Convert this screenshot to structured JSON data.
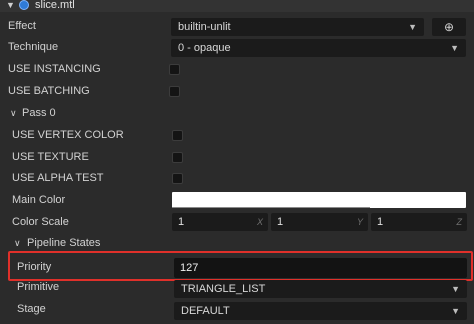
{
  "header": {
    "title": "slice.mtl",
    "chevron_icon": "chevron-down-icon",
    "file_icon": "material-file-icon"
  },
  "effect": {
    "label": "Effect",
    "value": "builtin-unlit",
    "locate_icon": "crosshair-icon"
  },
  "technique": {
    "label": "Technique",
    "value": "0 - opaque"
  },
  "use_instancing": {
    "label": "USE INSTANCING",
    "checked": false
  },
  "use_batching": {
    "label": "USE BATCHING",
    "checked": false
  },
  "pass": {
    "label": "Pass 0"
  },
  "use_vertex_color": {
    "label": "USE VERTEX COLOR",
    "checked": false
  },
  "use_texture": {
    "label": "USE TEXTURE",
    "checked": false
  },
  "use_alpha_test": {
    "label": "USE ALPHA TEST",
    "checked": false
  },
  "main_color": {
    "label": "Main Color",
    "color": "#ffffff"
  },
  "color_scale": {
    "label": "Color Scale",
    "x": {
      "value": "1",
      "axis": "X"
    },
    "y": {
      "value": "1",
      "axis": "Y"
    },
    "z": {
      "value": "1",
      "axis": "Z"
    }
  },
  "pipeline_states": {
    "label": "Pipeline States"
  },
  "priority": {
    "label": "Priority",
    "value": "127"
  },
  "primitive": {
    "label": "Primitive",
    "value": "TRIANGLE_LIST"
  },
  "stage": {
    "label": "Stage",
    "value": "DEFAULT"
  },
  "colors": {
    "highlight": "#e0302a",
    "background": "#2b2b2b",
    "field": "#1b1b1b"
  }
}
